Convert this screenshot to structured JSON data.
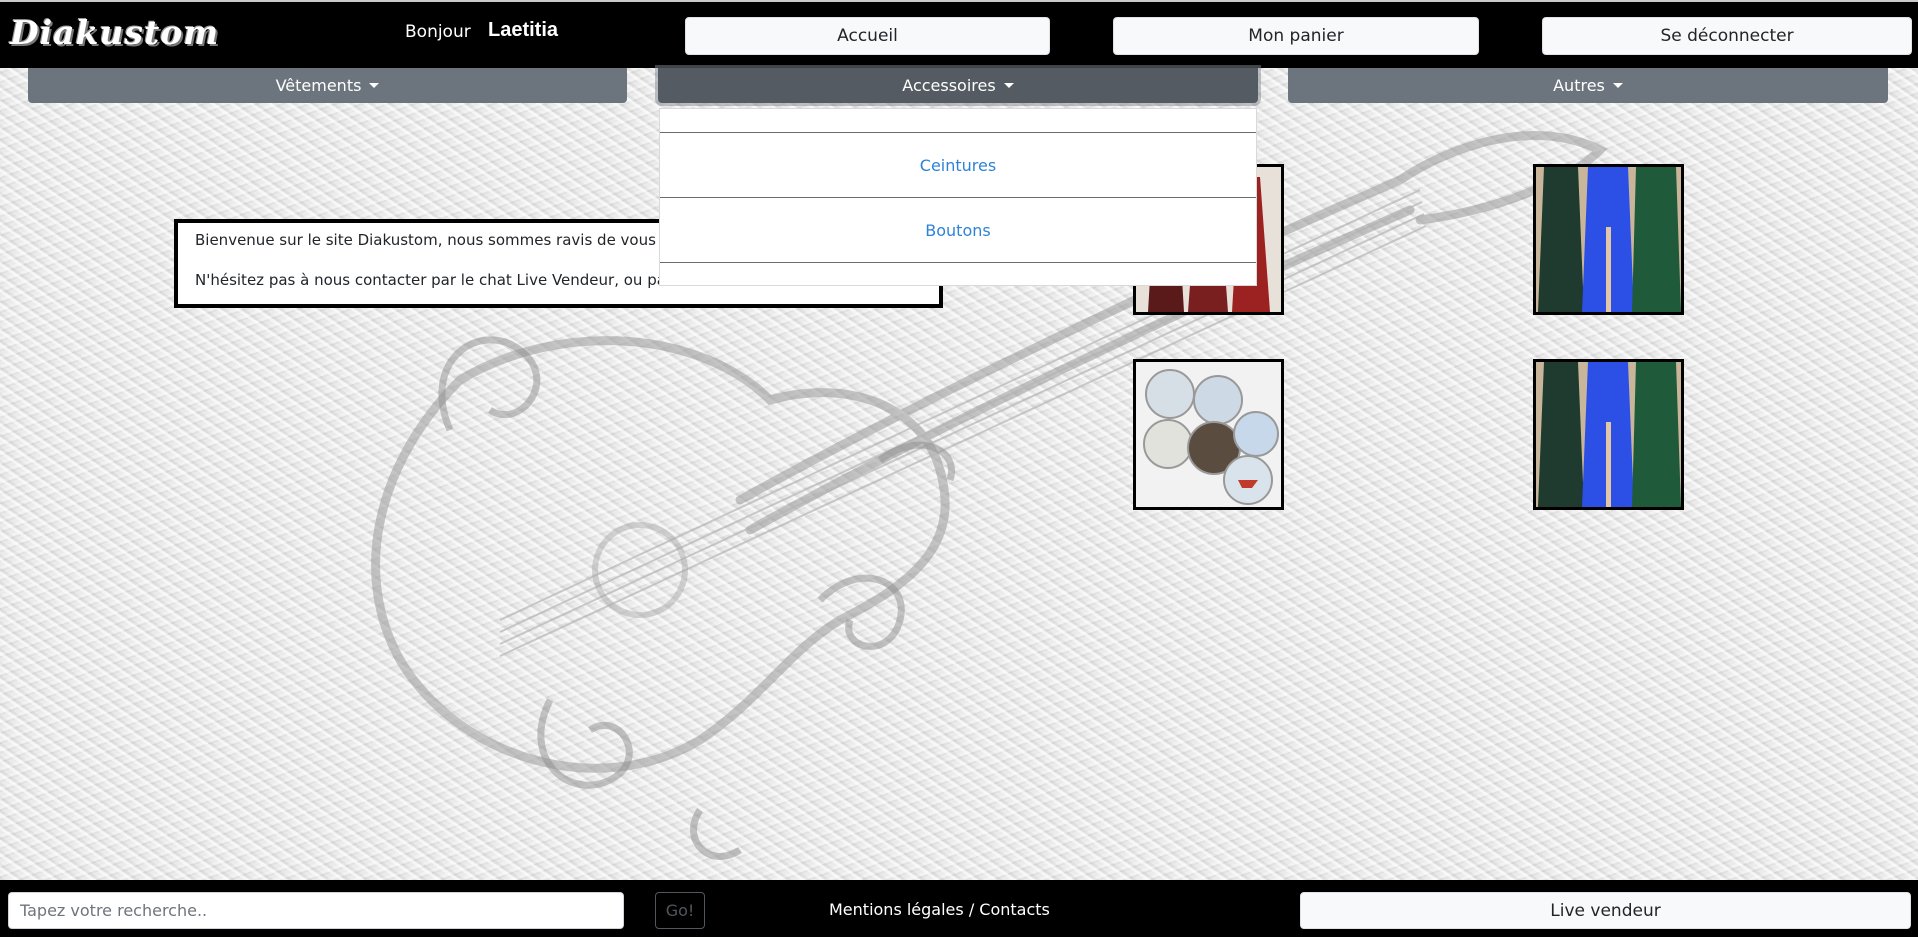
{
  "header": {
    "logo_text": "Diakustom",
    "greeting": "Bonjour",
    "username": "Laetitia",
    "nav": {
      "home": "Accueil",
      "cart": "Mon panier",
      "logout": "Se déconnecter"
    }
  },
  "categories": {
    "clothing": "Vêtements",
    "accessories": "Accessoires",
    "others": "Autres"
  },
  "dropdown": {
    "items": [
      "Ceintures",
      "Boutons"
    ]
  },
  "welcome": {
    "line1": "Bienvenue sur le site Diakustom, nous sommes ravis de vous accueillir",
    "line2": "N'hésitez pas à nous contacter par le chat Live Vendeur, ou pas mail"
  },
  "footer": {
    "search_placeholder": "Tapez votre recherche..",
    "go_label": "Go!",
    "legal_link": "Mentions légales / Contacts",
    "live_seller": "Live vendeur"
  },
  "colors": {
    "bar": "#000000",
    "category_button": "#6c757d",
    "link_blue": "#2f83d6"
  }
}
